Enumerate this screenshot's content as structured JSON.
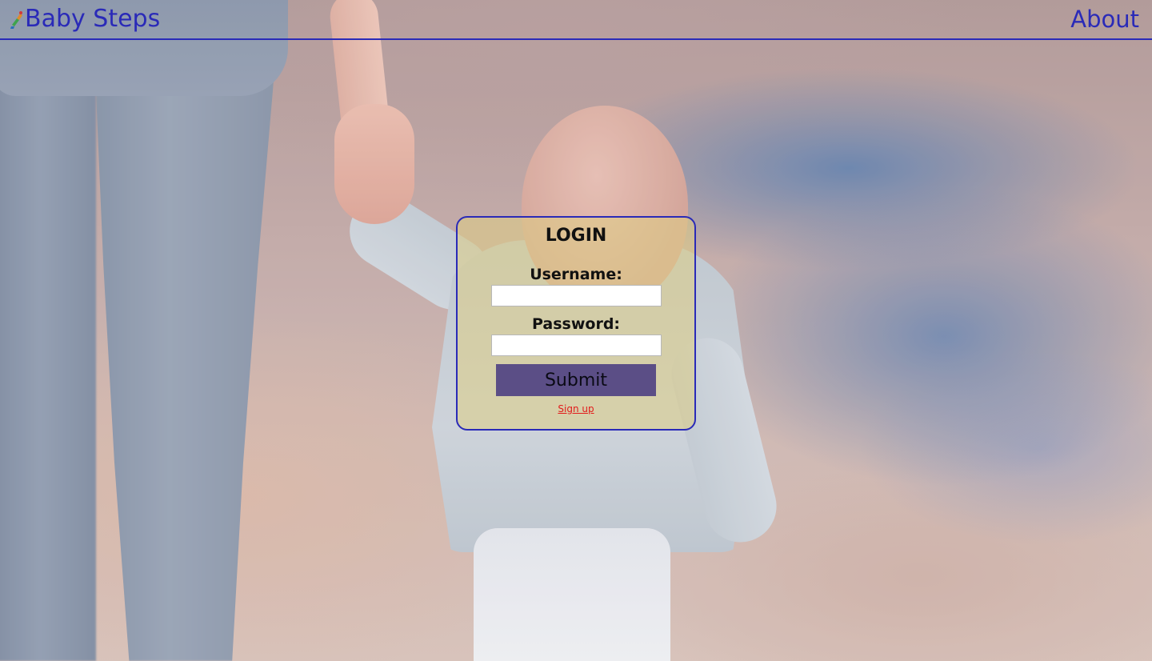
{
  "header": {
    "logo_text": "Baby Steps",
    "about_label": "About"
  },
  "login": {
    "title": "LOGIN",
    "username_label": "Username:",
    "username_value": "",
    "password_label": "Password:",
    "password_value": "",
    "submit_label": "Submit",
    "signup_label": "Sign up"
  },
  "colors": {
    "accent": "#2a2ab8",
    "card_background": "#decd84",
    "submit_background": "#5b4e86",
    "signup_link": "#e21b1b"
  },
  "icons": {
    "logo": "footsteps-icon"
  }
}
